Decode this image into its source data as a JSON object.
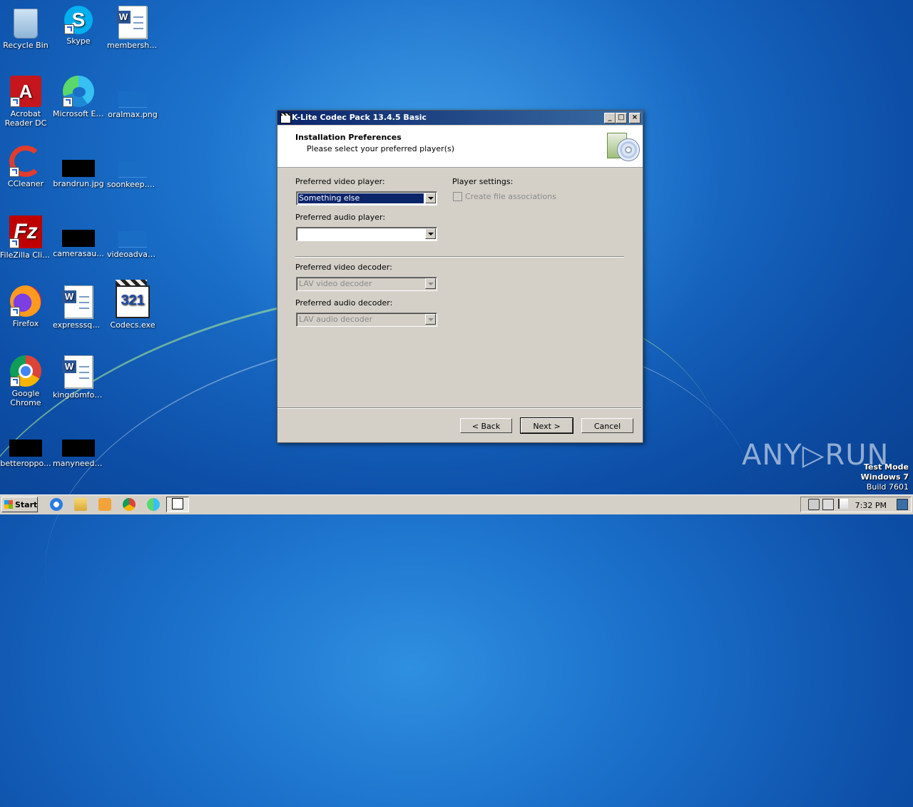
{
  "desktop": {
    "icons": [
      {
        "label": "Recycle Bin"
      },
      {
        "label": "Skype"
      },
      {
        "label": "membership..."
      },
      {
        "label": "Acrobat Reader DC"
      },
      {
        "label": "Microsoft Edge"
      },
      {
        "label": "oralmax.png"
      },
      {
        "label": "CCleaner"
      },
      {
        "label": "brandrun.jpg"
      },
      {
        "label": "soonkeep.png"
      },
      {
        "label": "FileZilla Client"
      },
      {
        "label": "camerasau..."
      },
      {
        "label": "videoadvan..."
      },
      {
        "label": "Firefox"
      },
      {
        "label": "expresssqu..."
      },
      {
        "label": "Codecs.exe"
      },
      {
        "label": "Google Chrome"
      },
      {
        "label": "kingdomfor..."
      },
      {
        "label": "betteroppo..."
      },
      {
        "label": "manyneede..."
      }
    ]
  },
  "dialog": {
    "title": "K-Lite Codec Pack 13.4.5 Basic",
    "header_title": "Installation Preferences",
    "header_subtitle": "Please select your preferred player(s)",
    "video_player_label": "Preferred video player:",
    "video_player_value": "Something else",
    "audio_player_label": "Preferred audio player:",
    "audio_player_value": "",
    "player_settings_label": "Player settings:",
    "file_assoc_label": "Create file associations",
    "video_decoder_label": "Preferred video decoder:",
    "video_decoder_value": "LAV video decoder",
    "audio_decoder_label": "Preferred audio decoder:",
    "audio_decoder_value": "LAV audio decoder",
    "back_label": "< Back",
    "next_label": "Next >",
    "cancel_label": "Cancel"
  },
  "watermark": {
    "brand": "ANY▷RUN",
    "test_mode": "Test Mode",
    "os": "Windows 7",
    "build": "Build 7601"
  },
  "taskbar": {
    "start_label": "Start",
    "clock": "7:32 PM"
  }
}
